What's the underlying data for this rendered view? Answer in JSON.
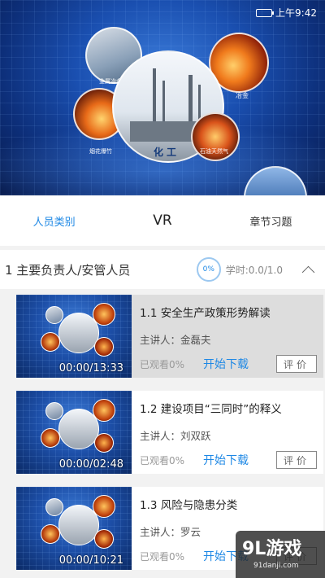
{
  "status_bar": {
    "time": "上午9:42",
    "battery_icon": "battery-icon"
  },
  "banner": {
    "center_label": "化工",
    "bubble_labels": [
      "金属冶金",
      "冶金",
      "烟花爆竹",
      "石油天然气"
    ]
  },
  "tabs": [
    {
      "label": "人员类别",
      "active": true
    },
    {
      "label": "VR",
      "active": false
    },
    {
      "label": "章节习题",
      "active": false
    }
  ],
  "section": {
    "title": "1 主要负责人/安管人员",
    "progress_label": "0%",
    "progress": 0,
    "study_time": "学时:0.0/1.0"
  },
  "lessons": [
    {
      "title": "1.1  安全生产政策形势解读",
      "lecturer": "主讲人：金磊夫",
      "duration": "00:00/13:33",
      "watched": "已观看0%",
      "download": "开始下载",
      "evaluate": "评价",
      "selected": true
    },
    {
      "title": "1.2  建设项目“三同时”的释义",
      "lecturer": "主讲人：刘双跃",
      "duration": "00:00/02:48",
      "watched": "已观看0%",
      "download": "开始下载",
      "evaluate": "评价",
      "selected": false
    },
    {
      "title": "1.3  风险与隐患分类",
      "lecturer": "主讲人：罗云",
      "duration": "00:00/10:21",
      "watched": "已观看0%",
      "download": "开始下载",
      "evaluate": "评价",
      "selected": false
    }
  ],
  "watermark": {
    "logo": "9L游戏",
    "site": "91danji.com"
  },
  "colors": {
    "accent": "#1e88e5",
    "banner_blue": "#1a4fb0"
  }
}
